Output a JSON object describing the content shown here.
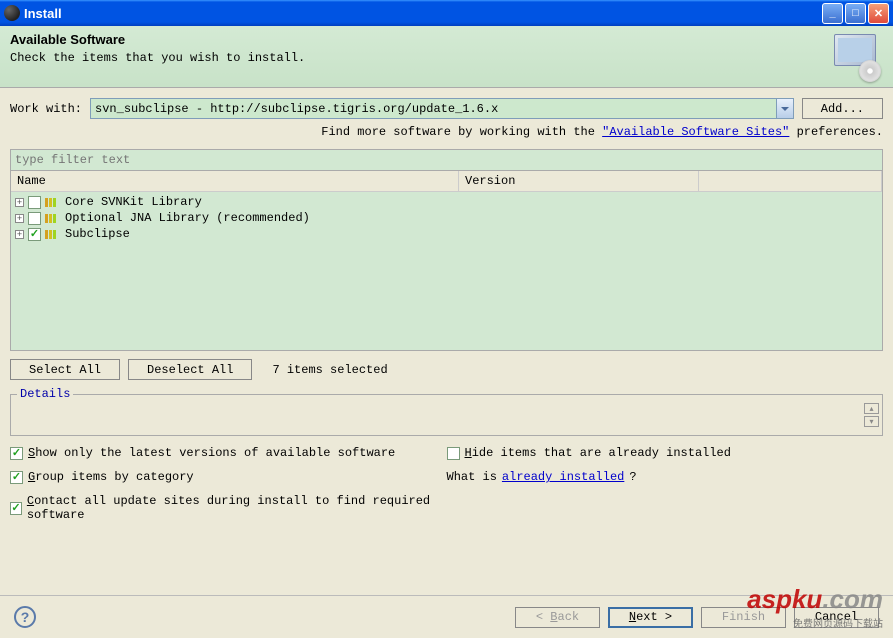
{
  "window": {
    "title": "Install"
  },
  "header": {
    "title": "Available Software",
    "subtitle": "Check the items that you wish to install."
  },
  "workwith": {
    "label": "Work with:",
    "value": "svn_subclipse - http://subclipse.tigris.org/update_1.6.x",
    "add_button": "Add...",
    "hint_prefix": "Find more software by working with the ",
    "hint_link": "\"Available Software Sites\"",
    "hint_suffix": " preferences."
  },
  "filter": {
    "placeholder": "type filter text"
  },
  "table": {
    "columns": {
      "name": "Name",
      "version": "Version"
    },
    "rows": [
      {
        "label": "Core SVNKit Library",
        "checked": false
      },
      {
        "label": "Optional JNA Library (recommended)",
        "checked": false
      },
      {
        "label": "Subclipse",
        "checked": true
      }
    ]
  },
  "selection": {
    "select_all": "Select All",
    "deselect_all": "Deselect All",
    "count_text": "7 items selected"
  },
  "details": {
    "legend": "Details"
  },
  "options": {
    "show_latest": {
      "label": "Show only the latest versions of available software",
      "checked": true
    },
    "group_category": {
      "label": "Group items by category",
      "checked": true
    },
    "contact_sites": {
      "label": "Contact all update sites during install to find required software",
      "checked": true
    },
    "hide_installed": {
      "label": "Hide items that are already installed",
      "checked": false
    },
    "whatis_prefix": "What is ",
    "whatis_link": "already installed",
    "whatis_suffix": "?"
  },
  "footer": {
    "back": "< Back",
    "next": "Next >",
    "finish": "Finish",
    "cancel": "Cancel"
  },
  "watermark": {
    "brand_red": "aspku",
    "brand_grey": ".com",
    "sub": "免费网页源码下载站"
  }
}
